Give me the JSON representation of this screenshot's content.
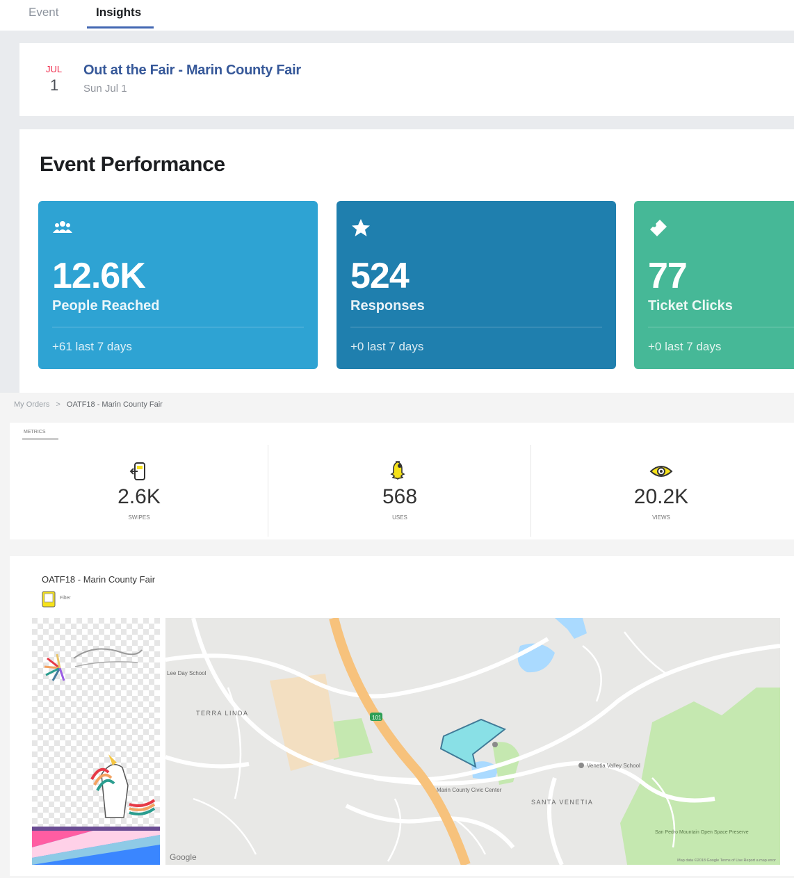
{
  "tabs": [
    {
      "label": "Event",
      "active": false
    },
    {
      "label": "Insights",
      "active": true
    }
  ],
  "event": {
    "month": "JUL",
    "day": "1",
    "title": "Out at the Fair - Marin County Fair",
    "date": "Sun Jul 1"
  },
  "performance": {
    "title": "Event Performance",
    "stats": [
      {
        "icon": "people-icon",
        "value": "12.6K",
        "label": "People Reached",
        "delta": "+61 last 7 days",
        "color": "#2ea3d3"
      },
      {
        "icon": "star-icon",
        "value": "524",
        "label": "Responses",
        "delta": "+0 last 7 days",
        "color": "#1f7fae"
      },
      {
        "icon": "ticket-icon",
        "value": "77",
        "label": "Ticket Clicks",
        "delta": "+0 last 7 days",
        "color": "#46b897"
      }
    ]
  },
  "breadcrumb": {
    "root": "My Orders",
    "separator": ">",
    "current": "OATF18 - Marin County Fair"
  },
  "metrics": {
    "tab_label": "METRICS",
    "items": [
      {
        "icon": "swipe-icon",
        "value": "2.6K",
        "label": "SWIPES"
      },
      {
        "icon": "snapchat-ghost-icon",
        "value": "568",
        "label": "USES"
      },
      {
        "icon": "eye-icon",
        "value": "20.2K",
        "label": "VIEWS"
      }
    ]
  },
  "geofilter": {
    "title": "OATF18 - Marin County Fair",
    "badge_label": "Filter",
    "map_labels": {
      "neighborhood_1": "TERRA LINDA",
      "neighborhood_2": "SANTA VENETIA",
      "poi_1": "Marin County Civic Center",
      "poi_2": "Venetia Valley School",
      "school": "Lee Day School",
      "park": "San Pedro Mountain Open Space Preserve",
      "highway": "101",
      "google": "Google",
      "map_credits": "Map data ©2018 Google   Terms of Use   Report a map error"
    }
  },
  "colors": {
    "facebook_blue": "#4267b2",
    "link_blue": "#365899",
    "geofence_fill": "#7fe0e6"
  }
}
